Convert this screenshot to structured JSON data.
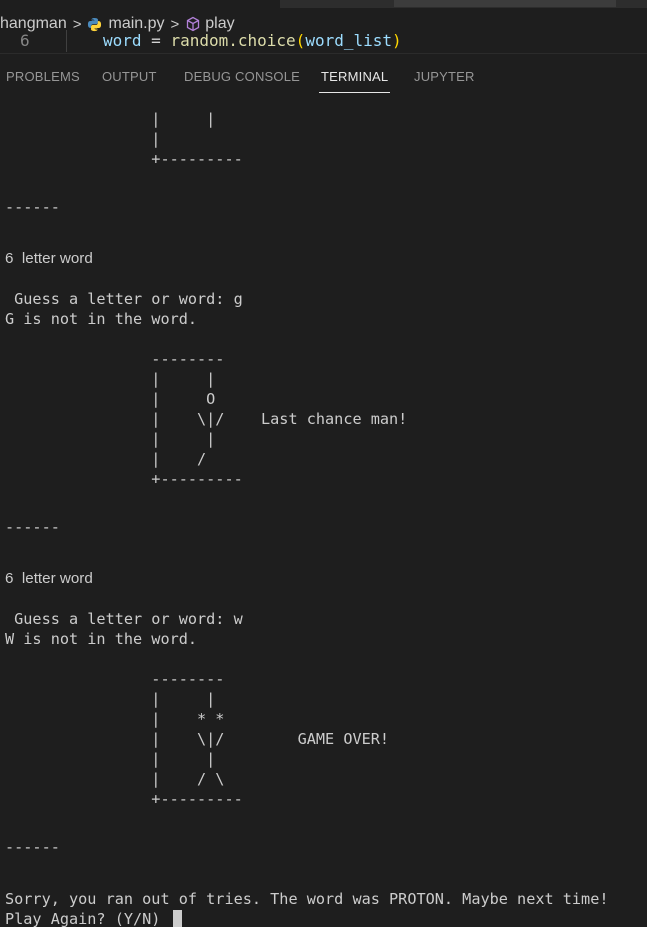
{
  "breadcrumb": {
    "folder": "hangman",
    "file": "main.py",
    "symbol": "play",
    "file_icon": "python-icon",
    "symbol_icon": "method-cube-icon"
  },
  "code_peek": {
    "line_number": "6",
    "var": "word",
    "op": " = ",
    "fn": "random.choice",
    "paren_open": "(",
    "arg": "word_list",
    "paren_close": ")"
  },
  "panel_tabs": [
    {
      "label": "PROBLEMS",
      "active": false
    },
    {
      "label": "OUTPUT",
      "active": false
    },
    {
      "label": "DEBUG CONSOLE",
      "active": false
    },
    {
      "label": "TERMINAL",
      "active": true
    },
    {
      "label": "JUPYTER",
      "active": false
    }
  ],
  "terminal": {
    "lines": [
      "                |     |",
      "                |",
      "                +---------",
      "------",
      "6  letter word",
      " Guess a letter or word: g",
      "G is not in the word.",
      "                --------",
      "                |     |",
      "                |     O",
      "                |    \\|/    Last chance man!",
      "                |     |",
      "                |    /",
      "                +---------",
      "------",
      "6  letter word",
      " Guess a letter or word: w",
      "W is not in the word.",
      "                --------",
      "                |     |",
      "                |    * *",
      "                |    \\|/        GAME OVER!",
      "                |     |",
      "                |    / \\",
      "                +---------",
      "------",
      "Sorry, you ran out of tries. The word was PROTON. Maybe next time!",
      "Play Again? (Y/N) "
    ]
  },
  "colors": {
    "background": "#1e1e1e",
    "text": "#cccccc",
    "inactive_tab": "#969696",
    "active_tab": "#e7e7e7"
  }
}
